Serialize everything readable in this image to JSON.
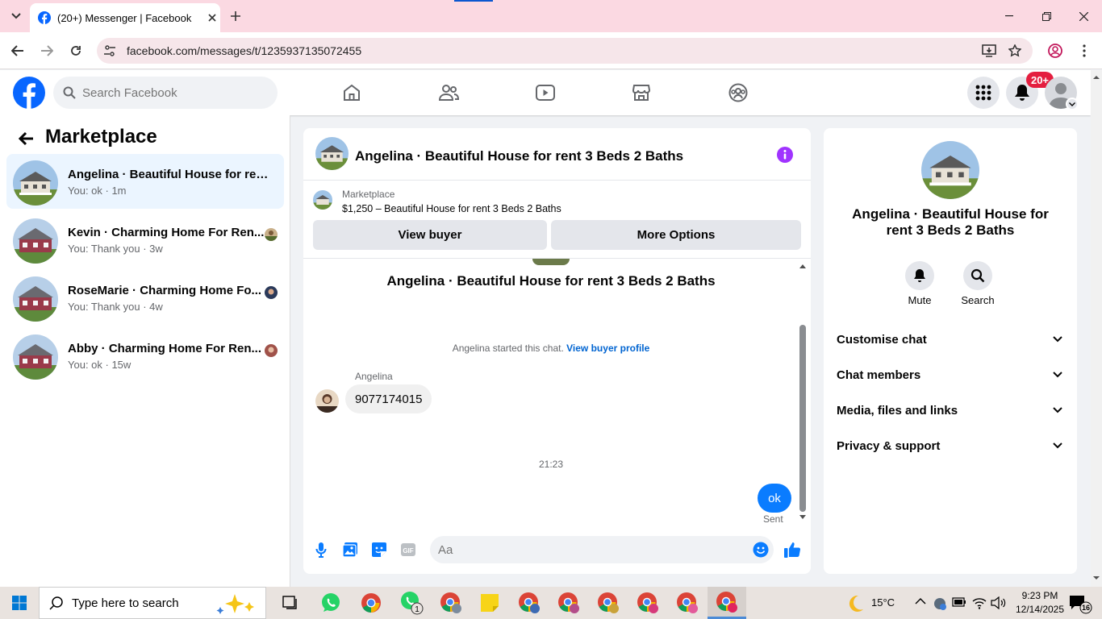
{
  "browser": {
    "tab_title": "(20+) Messenger | Facebook",
    "url": "facebook.com/messages/t/1235937135072455",
    "icons": [
      "tab-search-icon",
      "close-tab-icon",
      "new-tab-icon",
      "minimize-icon",
      "restore-icon",
      "close-window-icon",
      "back-icon",
      "forward-icon",
      "reload-icon",
      "site-info-icon",
      "install-app-icon",
      "bookmark-star-icon",
      "profile-icon",
      "more-menu-icon"
    ]
  },
  "facebook_header": {
    "search_placeholder": "Search Facebook",
    "notification_count": "20+",
    "nav_icons": [
      "home-icon",
      "friends-icon",
      "watch-icon",
      "marketplace-icon",
      "groups-icon"
    ]
  },
  "left_panel": {
    "title": "Marketplace",
    "conversations": [
      {
        "name": "Angelina · Beautiful House for rent...",
        "snippet": "You: ok · 1m"
      },
      {
        "name": "Kevin · Charming Home For Ren...",
        "snippet": "You: Thank you · 3w"
      },
      {
        "name": "RoseMarie · Charming Home Fo...",
        "snippet": "You: Thank you · 4w"
      },
      {
        "name": "Abby · Charming Home For Ren...",
        "snippet": "You: ok · 15w"
      }
    ]
  },
  "chat": {
    "header_name": "Angelina · Beautiful House for rent 3 Beds 2 Baths",
    "marketplace_label": "Marketplace",
    "listing": "$1,250 – Beautiful House for rent 3 Beds 2 Baths",
    "view_buyer": "View buyer",
    "more_options": "More Options",
    "intro_name": "Angelina · Beautiful House for rent 3 Beds 2 Baths",
    "started_text": "Angelina started this chat.",
    "view_buyer_profile": "View buyer profile",
    "sender_name": "Angelina",
    "incoming_message": "9077174015",
    "timestamp": "21:23",
    "outgoing_message": "ok",
    "sent_status": "Sent",
    "composer_placeholder": "Aa"
  },
  "info_panel": {
    "name": "Angelina · Beautiful House for rent 3 Beds 2 Baths",
    "mute_label": "Mute",
    "search_label": "Search",
    "sections": [
      "Customise chat",
      "Chat members",
      "Media, files and links",
      "Privacy & support"
    ]
  },
  "taskbar": {
    "search_placeholder": "Type here to search",
    "weather": "15°C",
    "time": "9:23 PM",
    "date": "12/14/2025",
    "notification_count": "16"
  },
  "colors": {
    "facebook_blue": "#0866ff",
    "messenger_blue": "#0a7cff",
    "notification_red": "#e41e3f",
    "info_purple": "#a033ff",
    "tab_strip_pink": "#fbd9e2"
  }
}
